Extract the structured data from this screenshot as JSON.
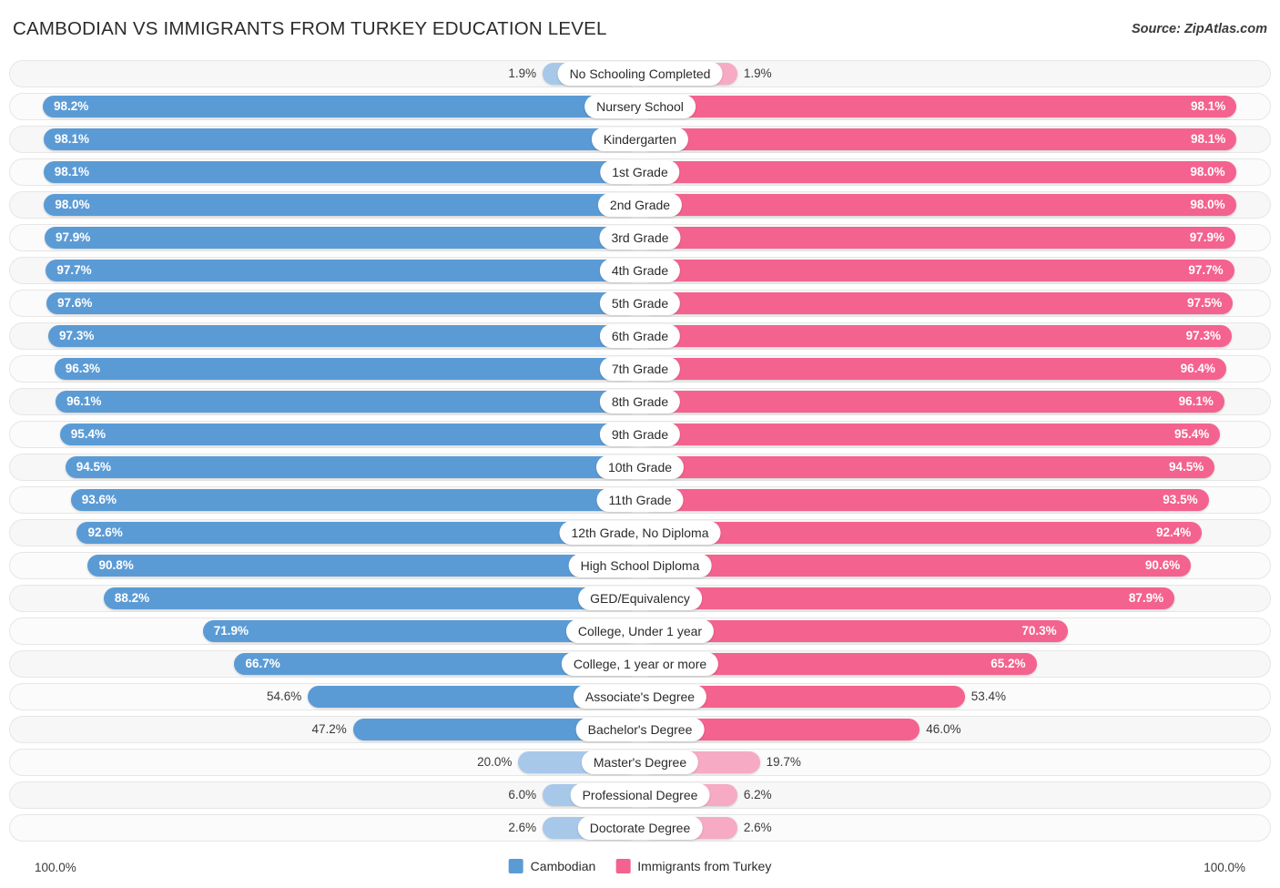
{
  "header": {
    "title": "CAMBODIAN VS IMMIGRANTS FROM TURKEY EDUCATION LEVEL",
    "source": "Source: ZipAtlas.com"
  },
  "legend": {
    "items": [
      {
        "label": "Cambodian",
        "color": "#5b9bd5"
      },
      {
        "label": "Immigrants from Turkey",
        "color": "#f4628f"
      }
    ]
  },
  "axis": {
    "left_max_label": "100.0%",
    "right_max_label": "100.0%"
  },
  "colors": {
    "blue": "#5b9bd5",
    "blue_light": "#a8c8ea",
    "pink": "#f4628f",
    "pink_light": "#f7aac4",
    "track": "#f7f7f7",
    "track_border": "#e6e6e6"
  },
  "chart_data": {
    "type": "bar",
    "subtype": "diverging-bidirectional",
    "title": "CAMBODIAN VS IMMIGRANTS FROM TURKEY EDUCATION LEVEL",
    "xlabel": "",
    "ylabel": "",
    "xlim": [
      0,
      100
    ],
    "grid": false,
    "legend_position": "bottom-center",
    "categories": [
      "No Schooling Completed",
      "Nursery School",
      "Kindergarten",
      "1st Grade",
      "2nd Grade",
      "3rd Grade",
      "4th Grade",
      "5th Grade",
      "6th Grade",
      "7th Grade",
      "8th Grade",
      "9th Grade",
      "10th Grade",
      "11th Grade",
      "12th Grade, No Diploma",
      "High School Diploma",
      "GED/Equivalency",
      "College, Under 1 year",
      "College, 1 year or more",
      "Associate's Degree",
      "Bachelor's Degree",
      "Master's Degree",
      "Professional Degree",
      "Doctorate Degree"
    ],
    "series": [
      {
        "name": "Cambodian",
        "side": "left",
        "color": "#5b9bd5",
        "values": [
          1.9,
          98.2,
          98.1,
          98.1,
          98.0,
          97.9,
          97.7,
          97.6,
          97.3,
          96.3,
          96.1,
          95.4,
          94.5,
          93.6,
          92.6,
          90.8,
          88.2,
          71.9,
          66.7,
          54.6,
          47.2,
          20.0,
          6.0,
          2.6
        ]
      },
      {
        "name": "Immigrants from Turkey",
        "side": "right",
        "color": "#f4628f",
        "values": [
          1.9,
          98.1,
          98.1,
          98.0,
          98.0,
          97.9,
          97.7,
          97.5,
          97.3,
          96.4,
          96.1,
          95.4,
          94.5,
          93.5,
          92.4,
          90.6,
          87.9,
          70.3,
          65.2,
          53.4,
          46.0,
          19.7,
          6.2,
          2.6
        ]
      }
    ],
    "rows": [
      {
        "category": "No Schooling Completed",
        "left": "1.9%",
        "right": "1.9%",
        "left_value": 1.9,
        "right_value": 1.9,
        "left_tone": "light",
        "right_tone": "light",
        "left_inside": false,
        "right_inside": false
      },
      {
        "category": "Nursery School",
        "left": "98.2%",
        "right": "98.1%",
        "left_value": 98.2,
        "right_value": 98.1,
        "left_tone": "solid",
        "right_tone": "solid",
        "left_inside": true,
        "right_inside": true
      },
      {
        "category": "Kindergarten",
        "left": "98.1%",
        "right": "98.1%",
        "left_value": 98.1,
        "right_value": 98.1,
        "left_tone": "solid",
        "right_tone": "solid",
        "left_inside": true,
        "right_inside": true
      },
      {
        "category": "1st Grade",
        "left": "98.1%",
        "right": "98.0%",
        "left_value": 98.1,
        "right_value": 98.0,
        "left_tone": "solid",
        "right_tone": "solid",
        "left_inside": true,
        "right_inside": true
      },
      {
        "category": "2nd Grade",
        "left": "98.0%",
        "right": "98.0%",
        "left_value": 98.0,
        "right_value": 98.0,
        "left_tone": "solid",
        "right_tone": "solid",
        "left_inside": true,
        "right_inside": true
      },
      {
        "category": "3rd Grade",
        "left": "97.9%",
        "right": "97.9%",
        "left_value": 97.9,
        "right_value": 97.9,
        "left_tone": "solid",
        "right_tone": "solid",
        "left_inside": true,
        "right_inside": true
      },
      {
        "category": "4th Grade",
        "left": "97.7%",
        "right": "97.7%",
        "left_value": 97.7,
        "right_value": 97.7,
        "left_tone": "solid",
        "right_tone": "solid",
        "left_inside": true,
        "right_inside": true
      },
      {
        "category": "5th Grade",
        "left": "97.6%",
        "right": "97.5%",
        "left_value": 97.6,
        "right_value": 97.5,
        "left_tone": "solid",
        "right_tone": "solid",
        "left_inside": true,
        "right_inside": true
      },
      {
        "category": "6th Grade",
        "left": "97.3%",
        "right": "97.3%",
        "left_value": 97.3,
        "right_value": 97.3,
        "left_tone": "solid",
        "right_tone": "solid",
        "left_inside": true,
        "right_inside": true
      },
      {
        "category": "7th Grade",
        "left": "96.3%",
        "right": "96.4%",
        "left_value": 96.3,
        "right_value": 96.4,
        "left_tone": "solid",
        "right_tone": "solid",
        "left_inside": true,
        "right_inside": true
      },
      {
        "category": "8th Grade",
        "left": "96.1%",
        "right": "96.1%",
        "left_value": 96.1,
        "right_value": 96.1,
        "left_tone": "solid",
        "right_tone": "solid",
        "left_inside": true,
        "right_inside": true
      },
      {
        "category": "9th Grade",
        "left": "95.4%",
        "right": "95.4%",
        "left_value": 95.4,
        "right_value": 95.4,
        "left_tone": "solid",
        "right_tone": "solid",
        "left_inside": true,
        "right_inside": true
      },
      {
        "category": "10th Grade",
        "left": "94.5%",
        "right": "94.5%",
        "left_value": 94.5,
        "right_value": 94.5,
        "left_tone": "solid",
        "right_tone": "solid",
        "left_inside": true,
        "right_inside": true
      },
      {
        "category": "11th Grade",
        "left": "93.6%",
        "right": "93.5%",
        "left_value": 93.6,
        "right_value": 93.5,
        "left_tone": "solid",
        "right_tone": "solid",
        "left_inside": true,
        "right_inside": true
      },
      {
        "category": "12th Grade, No Diploma",
        "left": "92.6%",
        "right": "92.4%",
        "left_value": 92.6,
        "right_value": 92.4,
        "left_tone": "solid",
        "right_tone": "solid",
        "left_inside": true,
        "right_inside": true
      },
      {
        "category": "High School Diploma",
        "left": "90.8%",
        "right": "90.6%",
        "left_value": 90.8,
        "right_value": 90.6,
        "left_tone": "solid",
        "right_tone": "solid",
        "left_inside": true,
        "right_inside": true
      },
      {
        "category": "GED/Equivalency",
        "left": "88.2%",
        "right": "87.9%",
        "left_value": 88.2,
        "right_value": 87.9,
        "left_tone": "solid",
        "right_tone": "solid",
        "left_inside": true,
        "right_inside": true
      },
      {
        "category": "College, Under 1 year",
        "left": "71.9%",
        "right": "70.3%",
        "left_value": 71.9,
        "right_value": 70.3,
        "left_tone": "solid",
        "right_tone": "solid",
        "left_inside": true,
        "right_inside": true
      },
      {
        "category": "College, 1 year or more",
        "left": "66.7%",
        "right": "65.2%",
        "left_value": 66.7,
        "right_value": 65.2,
        "left_tone": "solid",
        "right_tone": "solid",
        "left_inside": true,
        "right_inside": true
      },
      {
        "category": "Associate's Degree",
        "left": "54.6%",
        "right": "53.4%",
        "left_value": 54.6,
        "right_value": 53.4,
        "left_tone": "solid",
        "right_tone": "solid",
        "left_inside": false,
        "right_inside": false
      },
      {
        "category": "Bachelor's Degree",
        "left": "47.2%",
        "right": "46.0%",
        "left_value": 47.2,
        "right_value": 46.0,
        "left_tone": "solid",
        "right_tone": "solid",
        "left_inside": false,
        "right_inside": false
      },
      {
        "category": "Master's Degree",
        "left": "20.0%",
        "right": "19.7%",
        "left_value": 20.0,
        "right_value": 19.7,
        "left_tone": "light",
        "right_tone": "light",
        "left_inside": false,
        "right_inside": false
      },
      {
        "category": "Professional Degree",
        "left": "6.0%",
        "right": "6.2%",
        "left_value": 6.0,
        "right_value": 6.2,
        "left_tone": "light",
        "right_tone": "light",
        "left_inside": false,
        "right_inside": false
      },
      {
        "category": "Doctorate Degree",
        "left": "2.6%",
        "right": "2.6%",
        "left_value": 2.6,
        "right_value": 2.6,
        "left_tone": "light",
        "right_tone": "light",
        "left_inside": false,
        "right_inside": false
      }
    ]
  }
}
